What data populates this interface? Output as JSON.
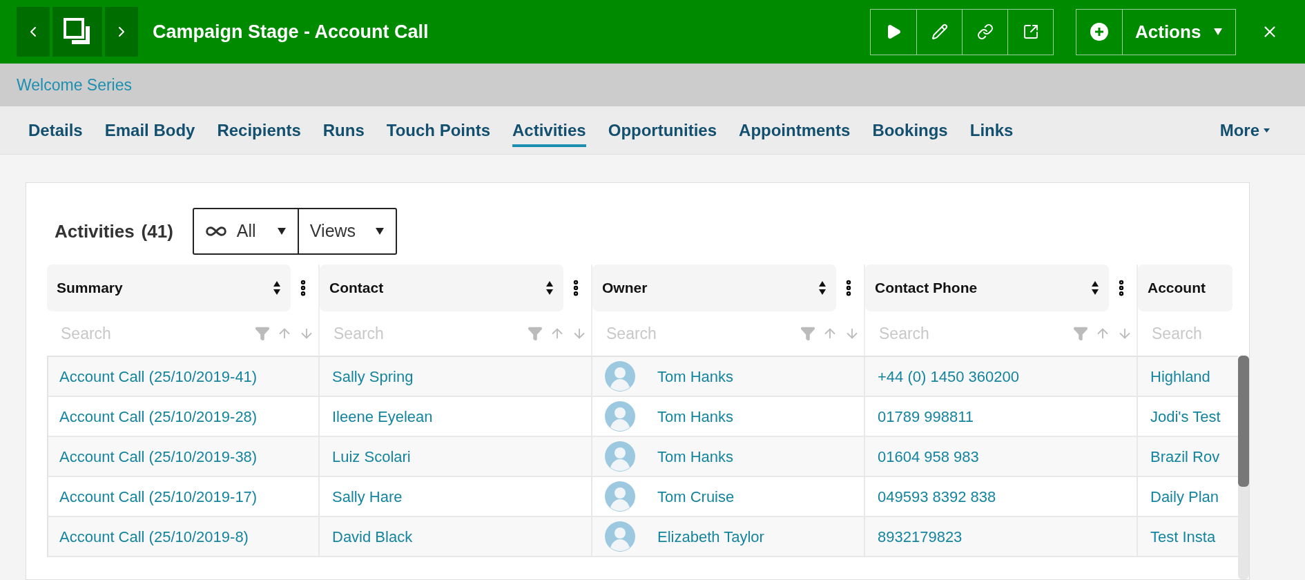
{
  "header": {
    "title": "Campaign Stage - Account Call",
    "actions_label": "Actions"
  },
  "breadcrumb": {
    "label": "Welcome Series"
  },
  "tabs": [
    {
      "label": "Details",
      "selected": false
    },
    {
      "label": "Email Body",
      "selected": false
    },
    {
      "label": "Recipients",
      "selected": false
    },
    {
      "label": "Runs",
      "selected": false
    },
    {
      "label": "Touch Points",
      "selected": false
    },
    {
      "label": "Activities",
      "selected": true
    },
    {
      "label": "Opportunities",
      "selected": false
    },
    {
      "label": "Appointments",
      "selected": false
    },
    {
      "label": "Bookings",
      "selected": false
    },
    {
      "label": "Links",
      "selected": false
    }
  ],
  "more_label": "More",
  "panel": {
    "title": "Activities",
    "count": "(41)",
    "filter_label": "All",
    "views_label": "Views"
  },
  "table": {
    "columns": [
      {
        "label": "Summary",
        "placeholder": "Search",
        "has_controls": true
      },
      {
        "label": "Contact",
        "placeholder": "Search",
        "has_controls": true
      },
      {
        "label": "Owner",
        "placeholder": "Search",
        "has_controls": true
      },
      {
        "label": "Contact Phone",
        "placeholder": "Search",
        "has_controls": true
      },
      {
        "label": "Account",
        "placeholder": "Search",
        "has_controls": false
      }
    ],
    "rows": [
      {
        "summary": "Account Call (25/10/2019-41)",
        "contact": "Sally Spring",
        "owner": "Tom Hanks",
        "phone": "+44 (0) 1450 360200",
        "account": "Highland"
      },
      {
        "summary": "Account Call (25/10/2019-28)",
        "contact": "Ileene Eyelean",
        "owner": "Tom Hanks",
        "phone": "01789 998811",
        "account": "Jodi's Test"
      },
      {
        "summary": "Account Call (25/10/2019-38)",
        "contact": "Luiz Scolari",
        "owner": "Tom Hanks",
        "phone": "01604 958 983",
        "account": "Brazil Rov"
      },
      {
        "summary": "Account Call (25/10/2019-17)",
        "contact": "Sally Hare",
        "owner": "Tom Cruise",
        "phone": "049593 8392 838",
        "account": "Daily Plan"
      },
      {
        "summary": "Account Call (25/10/2019-8)",
        "contact": "David Black",
        "owner": "Elizabeth Taylor",
        "phone": "8932179823",
        "account": "Test Insta"
      }
    ]
  }
}
